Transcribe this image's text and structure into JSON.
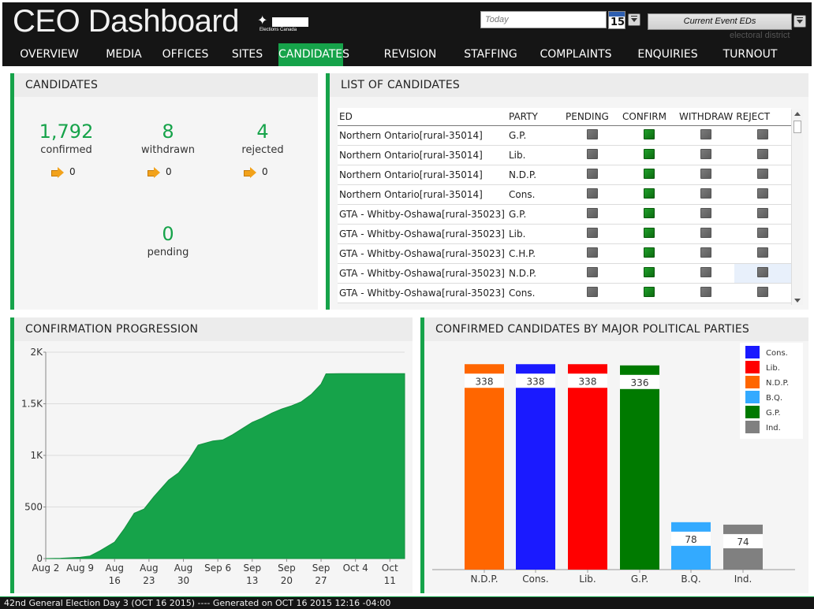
{
  "header": {
    "title": "CEO Dashboard",
    "logo_text": "Elections Canada",
    "date_placeholder": "Today",
    "calendar_day": "15",
    "event_select": "Current Event EDs",
    "event_sub": "electoral district"
  },
  "nav": [
    {
      "label": "OVERVIEW",
      "active": false
    },
    {
      "label": "MEDIA",
      "active": false
    },
    {
      "label": "OFFICES",
      "active": false
    },
    {
      "label": "SITES",
      "active": false
    },
    {
      "label": "CANDIDATES",
      "active": true
    },
    {
      "label": "REVISION",
      "active": false
    },
    {
      "label": "STAFFING",
      "active": false
    },
    {
      "label": "COMPLAINTS",
      "active": false
    },
    {
      "label": "ENQUIRIES",
      "active": false
    },
    {
      "label": "TURNOUT",
      "active": false
    }
  ],
  "candidates": {
    "title": "CANDIDATES",
    "confirmed": {
      "value": "1,792",
      "label": "confirmed",
      "delta": "0"
    },
    "withdrawn": {
      "value": "8",
      "label": "withdrawn",
      "delta": "0"
    },
    "rejected": {
      "value": "4",
      "label": "rejected",
      "delta": "0"
    },
    "pending": {
      "value": "0",
      "label": "pending"
    }
  },
  "list": {
    "title": "LIST OF CANDIDATES",
    "columns": [
      "ED",
      "PARTY",
      "PENDING",
      "CONFIRM",
      "WITHDRAW",
      "REJECT"
    ],
    "rows": [
      {
        "ed": "Northern Ontario[rural-35014]",
        "party": "G.P."
      },
      {
        "ed": "Northern Ontario[rural-35014]",
        "party": "Lib."
      },
      {
        "ed": "Northern Ontario[rural-35014]",
        "party": "N.D.P."
      },
      {
        "ed": "Northern Ontario[rural-35014]",
        "party": "Cons."
      },
      {
        "ed": "GTA - Whitby-Oshawa[rural-35023]",
        "party": "G.P."
      },
      {
        "ed": "GTA - Whitby-Oshawa[rural-35023]",
        "party": "Lib."
      },
      {
        "ed": "GTA - Whitby-Oshawa[rural-35023]",
        "party": "C.H.P."
      },
      {
        "ed": "GTA - Whitby-Oshawa[rural-35023]",
        "party": "N.D.P."
      },
      {
        "ed": "GTA - Whitby-Oshawa[rural-35023]",
        "party": "Cons."
      }
    ]
  },
  "progression": {
    "title": "CONFIRMATION PROGRESSION"
  },
  "parties": {
    "title": "CONFIRMED CANDIDATES BY MAJOR POLITICAL PARTIES"
  },
  "footer": "42nd General Election Day 3 (OCT 16 2015) ---- Generated on OCT 16 2015 12:16 -04:00",
  "colors": {
    "accent": "#16a34a",
    "header_bg": "#151515"
  },
  "chart_data": [
    {
      "type": "area",
      "title": "CONFIRMATION PROGRESSION",
      "xlabel": "",
      "ylabel": "",
      "ylim": [
        0,
        2000
      ],
      "y_ticks": [
        "0",
        "500",
        "1K",
        "1.5K",
        "2K"
      ],
      "x_ticks": [
        {
          "top": "Aug 2",
          "bottom": ""
        },
        {
          "top": "Aug 9",
          "bottom": ""
        },
        {
          "top": "Aug",
          "bottom": "16"
        },
        {
          "top": "Aug",
          "bottom": "23"
        },
        {
          "top": "Aug",
          "bottom": "30"
        },
        {
          "top": "Sep 6",
          "bottom": ""
        },
        {
          "top": "Sep",
          "bottom": "13"
        },
        {
          "top": "Sep",
          "bottom": "20"
        },
        {
          "top": "Sep",
          "bottom": "27"
        },
        {
          "top": "Oct 4",
          "bottom": ""
        },
        {
          "top": "Oct",
          "bottom": "11"
        }
      ],
      "x": [
        "Aug 2",
        "Aug 5",
        "Aug 9",
        "Aug 11",
        "Aug 13",
        "Aug 16",
        "Aug 18",
        "Aug 20",
        "Aug 22",
        "Aug 24",
        "Aug 27",
        "Aug 29",
        "Aug 31",
        "Sep 2",
        "Sep 5",
        "Sep 7",
        "Sep 9",
        "Sep 11",
        "Sep 13",
        "Sep 15",
        "Sep 17",
        "Sep 19",
        "Sep 21",
        "Sep 23",
        "Sep 25",
        "Sep 27",
        "Sep 28",
        "Oct 1",
        "Oct 4",
        "Oct 7",
        "Oct 11",
        "Oct 14"
      ],
      "values": [
        0,
        3,
        12,
        25,
        75,
        160,
        290,
        440,
        480,
        600,
        760,
        830,
        950,
        1100,
        1140,
        1150,
        1200,
        1260,
        1320,
        1360,
        1410,
        1450,
        1480,
        1520,
        1590,
        1690,
        1790,
        1792,
        1792,
        1792,
        1792,
        1792
      ]
    },
    {
      "type": "bar",
      "title": "CONFIRMED CANDIDATES BY MAJOR POLITICAL PARTIES",
      "categories": [
        "N.D.P.",
        "Cons.",
        "Lib.",
        "G.P.",
        "B.Q.",
        "Ind."
      ],
      "values": [
        338,
        338,
        338,
        336,
        78,
        74
      ],
      "colors": [
        "#ff6600",
        "#1a1aff",
        "#ff0000",
        "#007a00",
        "#33aaff",
        "#808080"
      ],
      "ylim": [
        0,
        350
      ],
      "legend": [
        "Cons.",
        "Lib.",
        "N.D.P.",
        "B.Q.",
        "G.P.",
        "Ind."
      ],
      "legend_colors": [
        "#1a1aff",
        "#ff0000",
        "#ff6600",
        "#33aaff",
        "#007a00",
        "#808080"
      ],
      "legend_position": "top-right"
    }
  ]
}
